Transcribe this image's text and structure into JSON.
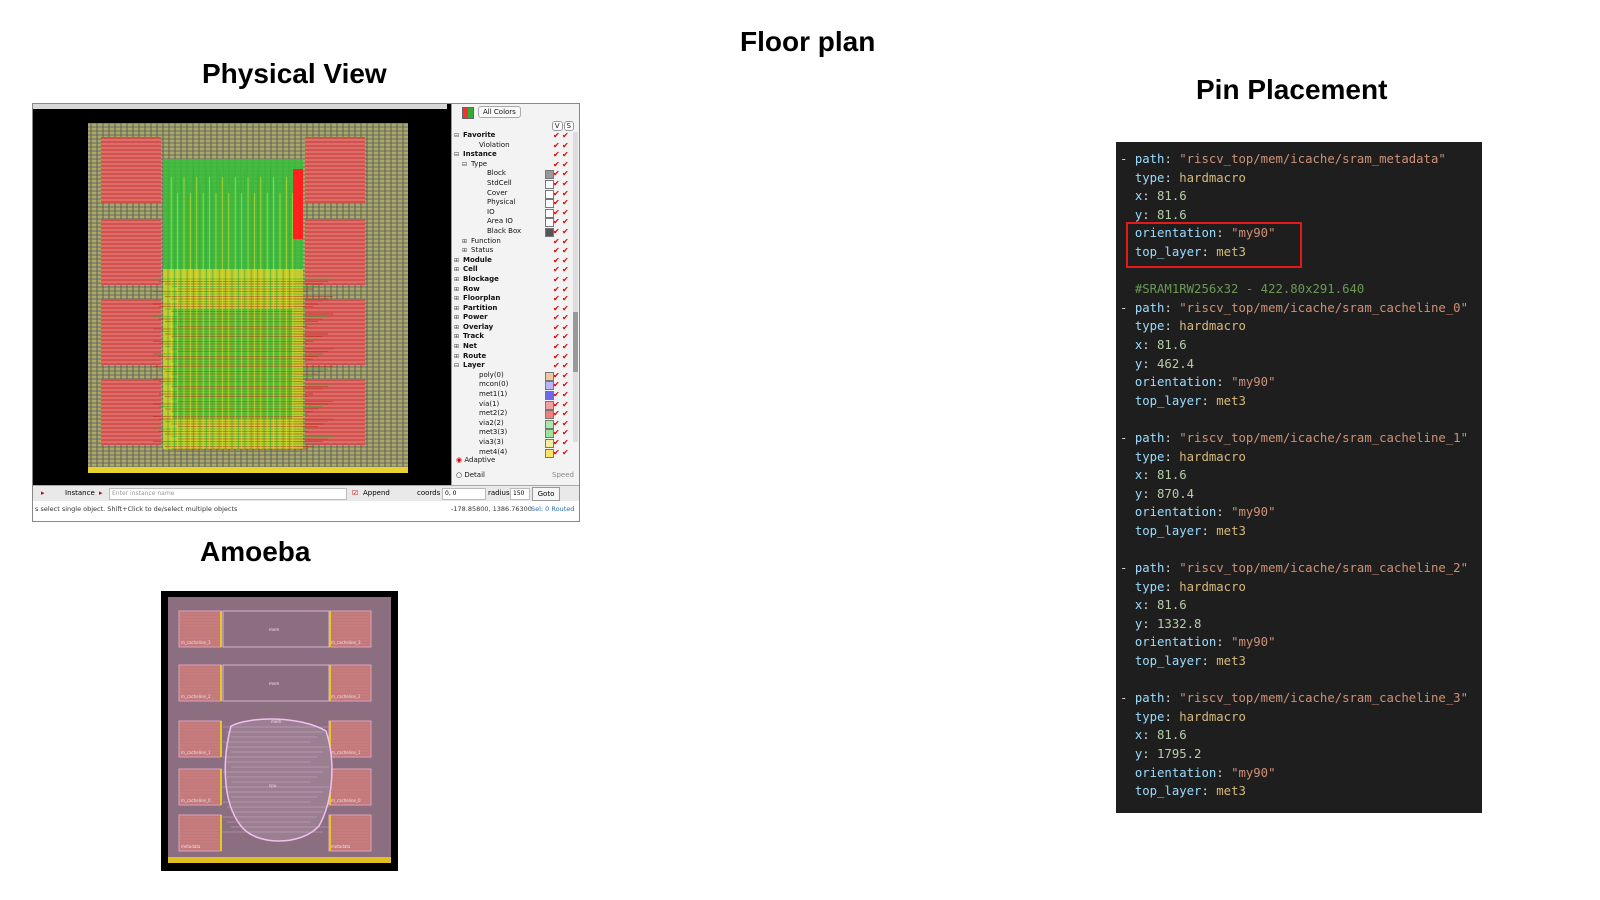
{
  "titles": {
    "main": "Floor plan",
    "physical": "Physical View",
    "amoeba": "Amoeba",
    "pins": "Pin Placement"
  },
  "viewer": {
    "all_colors": "All Colors",
    "v_button": "V",
    "s_button": "S",
    "tree": [
      {
        "label": "Favorite",
        "indent": 0,
        "bold": true,
        "exp": "⊟"
      },
      {
        "label": "Violation",
        "indent": 2,
        "bold": false,
        "exp": ""
      },
      {
        "label": "Instance",
        "indent": 0,
        "bold": true,
        "exp": "⊟"
      },
      {
        "label": "Type",
        "indent": 1,
        "bold": false,
        "exp": "⊟"
      },
      {
        "label": "Block",
        "indent": 3,
        "bold": false,
        "exp": ""
      },
      {
        "label": "StdCell",
        "indent": 3,
        "bold": false,
        "exp": ""
      },
      {
        "label": "Cover",
        "indent": 3,
        "bold": false,
        "exp": ""
      },
      {
        "label": "Physical",
        "indent": 3,
        "bold": false,
        "exp": ""
      },
      {
        "label": "IO",
        "indent": 3,
        "bold": false,
        "exp": ""
      },
      {
        "label": "Area IO",
        "indent": 3,
        "bold": false,
        "exp": ""
      },
      {
        "label": "Black Box",
        "indent": 3,
        "bold": false,
        "exp": ""
      },
      {
        "label": "Function",
        "indent": 1,
        "bold": false,
        "exp": "⊞"
      },
      {
        "label": "Status",
        "indent": 1,
        "bold": false,
        "exp": "⊞"
      },
      {
        "label": "Module",
        "indent": 0,
        "bold": true,
        "exp": "⊞"
      },
      {
        "label": "Cell",
        "indent": 0,
        "bold": true,
        "exp": "⊞"
      },
      {
        "label": "Blockage",
        "indent": 0,
        "bold": true,
        "exp": "⊞"
      },
      {
        "label": "Row",
        "indent": 0,
        "bold": true,
        "exp": "⊞"
      },
      {
        "label": "Floorplan",
        "indent": 0,
        "bold": true,
        "exp": "⊞"
      },
      {
        "label": "Partition",
        "indent": 0,
        "bold": true,
        "exp": "⊞"
      },
      {
        "label": "Power",
        "indent": 0,
        "bold": true,
        "exp": "⊞"
      },
      {
        "label": "Overlay",
        "indent": 0,
        "bold": true,
        "exp": "⊞"
      },
      {
        "label": "Track",
        "indent": 0,
        "bold": true,
        "exp": "⊞"
      },
      {
        "label": "Net",
        "indent": 0,
        "bold": true,
        "exp": "⊞"
      },
      {
        "label": "Route",
        "indent": 0,
        "bold": true,
        "exp": "⊞"
      },
      {
        "label": "Layer",
        "indent": 0,
        "bold": true,
        "exp": "⊟"
      },
      {
        "label": "poly(0)",
        "indent": 2,
        "bold": false,
        "exp": "",
        "swatch": "#f4c7a0"
      },
      {
        "label": "mcon(0)",
        "indent": 2,
        "bold": false,
        "exp": "",
        "swatch": "#b8b8f8"
      },
      {
        "label": "met1(1)",
        "indent": 2,
        "bold": false,
        "exp": "",
        "swatch": "#6a6ae8"
      },
      {
        "label": "via(1)",
        "indent": 2,
        "bold": false,
        "exp": "",
        "swatch": "#f0a0a0"
      },
      {
        "label": "met2(2)",
        "indent": 2,
        "bold": false,
        "exp": "",
        "swatch": "#f08080"
      },
      {
        "label": "via2(2)",
        "indent": 2,
        "bold": false,
        "exp": "",
        "swatch": "#a8e8a8"
      },
      {
        "label": "met3(3)",
        "indent": 2,
        "bold": false,
        "exp": "",
        "swatch": "#9de39d"
      },
      {
        "label": "via3(3)",
        "indent": 2,
        "bold": false,
        "exp": "",
        "swatch": "#f0f0a0"
      },
      {
        "label": "met4(4)",
        "indent": 2,
        "bold": false,
        "exp": "",
        "swatch": "#f5e56a"
      }
    ],
    "adaptive": "Adaptive",
    "detail": "Detail",
    "speed": "Speed",
    "bottom": {
      "instance_label": "Instance",
      "instance_placeholder": "Enter instance name",
      "append_label": "Append",
      "coords_label": "coords",
      "coords_value": "0, 0",
      "radius_label": "radius",
      "radius_value": "150",
      "goto_label": "Goto"
    },
    "status_left": "s select single object. Shift+Click to de/select multiple objects",
    "status_right": "-178.85800, 1386.76300",
    "status_sel": "Sel: 0 Routed"
  },
  "amoeba": {
    "macro_labels": [
      "m_cacheline_3",
      "m_cacheline_3",
      "m_cacheline_2",
      "m_cacheline_2",
      "m_cacheline_1",
      "m_cacheline_1",
      "m_cacheline_0",
      "m_cacheline_0",
      "metadata",
      "metadata"
    ],
    "block_labels": [
      "mem",
      "mem",
      "mem",
      "cpu"
    ]
  },
  "code": {
    "lines": [
      [
        [
          "- ",
          "dash"
        ],
        [
          "path",
          "k"
        ],
        [
          ": ",
          "p"
        ],
        [
          "\"riscv_top/mem/icache/sram_metadata\"",
          "s"
        ]
      ],
      [
        [
          "  ",
          "p"
        ],
        [
          "type",
          "k"
        ],
        [
          ": ",
          "p"
        ],
        [
          "hardmacro",
          "ty"
        ]
      ],
      [
        [
          "  ",
          "p"
        ],
        [
          "x",
          "k"
        ],
        [
          ": ",
          "p"
        ],
        [
          "81.6",
          "n"
        ]
      ],
      [
        [
          "  ",
          "p"
        ],
        [
          "y",
          "k"
        ],
        [
          ": ",
          "p"
        ],
        [
          "81.6",
          "n"
        ]
      ],
      [
        [
          "  ",
          "p"
        ],
        [
          "orientation",
          "k"
        ],
        [
          ": ",
          "p"
        ],
        [
          "\"my90\"",
          "s"
        ]
      ],
      [
        [
          "  ",
          "p"
        ],
        [
          "top_layer",
          "k"
        ],
        [
          ": ",
          "p"
        ],
        [
          "met3",
          "ty"
        ]
      ],
      [
        [
          "",
          "p"
        ]
      ],
      [
        [
          "  ",
          "p"
        ],
        [
          "#SRAM1RW256x32 - 422.80x291.640",
          "c"
        ]
      ],
      [
        [
          "- ",
          "dash"
        ],
        [
          "path",
          "k"
        ],
        [
          ": ",
          "p"
        ],
        [
          "\"riscv_top/mem/icache/sram_cacheline_0\"",
          "s"
        ]
      ],
      [
        [
          "  ",
          "p"
        ],
        [
          "type",
          "k"
        ],
        [
          ": ",
          "p"
        ],
        [
          "hardmacro",
          "ty"
        ]
      ],
      [
        [
          "  ",
          "p"
        ],
        [
          "x",
          "k"
        ],
        [
          ": ",
          "p"
        ],
        [
          "81.6",
          "n"
        ]
      ],
      [
        [
          "  ",
          "p"
        ],
        [
          "y",
          "k"
        ],
        [
          ": ",
          "p"
        ],
        [
          "462.4",
          "n"
        ]
      ],
      [
        [
          "  ",
          "p"
        ],
        [
          "orientation",
          "k"
        ],
        [
          ": ",
          "p"
        ],
        [
          "\"my90\"",
          "s"
        ]
      ],
      [
        [
          "  ",
          "p"
        ],
        [
          "top_layer",
          "k"
        ],
        [
          ": ",
          "p"
        ],
        [
          "met3",
          "ty"
        ]
      ],
      [
        [
          "",
          "p"
        ]
      ],
      [
        [
          "- ",
          "dash"
        ],
        [
          "path",
          "k"
        ],
        [
          ": ",
          "p"
        ],
        [
          "\"riscv_top/mem/icache/sram_cacheline_1\"",
          "s"
        ]
      ],
      [
        [
          "  ",
          "p"
        ],
        [
          "type",
          "k"
        ],
        [
          ": ",
          "p"
        ],
        [
          "hardmacro",
          "ty"
        ]
      ],
      [
        [
          "  ",
          "p"
        ],
        [
          "x",
          "k"
        ],
        [
          ": ",
          "p"
        ],
        [
          "81.6",
          "n"
        ]
      ],
      [
        [
          "  ",
          "p"
        ],
        [
          "y",
          "k"
        ],
        [
          ": ",
          "p"
        ],
        [
          "870.4",
          "n"
        ]
      ],
      [
        [
          "  ",
          "p"
        ],
        [
          "orientation",
          "k"
        ],
        [
          ": ",
          "p"
        ],
        [
          "\"my90\"",
          "s"
        ]
      ],
      [
        [
          "  ",
          "p"
        ],
        [
          "top_layer",
          "k"
        ],
        [
          ": ",
          "p"
        ],
        [
          "met3",
          "ty"
        ]
      ],
      [
        [
          "",
          "p"
        ]
      ],
      [
        [
          "- ",
          "dash"
        ],
        [
          "path",
          "k"
        ],
        [
          ": ",
          "p"
        ],
        [
          "\"riscv_top/mem/icache/sram_cacheline_2\"",
          "s"
        ]
      ],
      [
        [
          "  ",
          "p"
        ],
        [
          "type",
          "k"
        ],
        [
          ": ",
          "p"
        ],
        [
          "hardmacro",
          "ty"
        ]
      ],
      [
        [
          "  ",
          "p"
        ],
        [
          "x",
          "k"
        ],
        [
          ": ",
          "p"
        ],
        [
          "81.6",
          "n"
        ]
      ],
      [
        [
          "  ",
          "p"
        ],
        [
          "y",
          "k"
        ],
        [
          ": ",
          "p"
        ],
        [
          "1332.8",
          "n"
        ]
      ],
      [
        [
          "  ",
          "p"
        ],
        [
          "orientation",
          "k"
        ],
        [
          ": ",
          "p"
        ],
        [
          "\"my90\"",
          "s"
        ]
      ],
      [
        [
          "  ",
          "p"
        ],
        [
          "top_layer",
          "k"
        ],
        [
          ": ",
          "p"
        ],
        [
          "met3",
          "ty"
        ]
      ],
      [
        [
          "",
          "p"
        ]
      ],
      [
        [
          "- ",
          "dash"
        ],
        [
          "path",
          "k"
        ],
        [
          ": ",
          "p"
        ],
        [
          "\"riscv_top/mem/icache/sram_cacheline_3\"",
          "s"
        ]
      ],
      [
        [
          "  ",
          "p"
        ],
        [
          "type",
          "k"
        ],
        [
          ": ",
          "p"
        ],
        [
          "hardmacro",
          "ty"
        ]
      ],
      [
        [
          "  ",
          "p"
        ],
        [
          "x",
          "k"
        ],
        [
          ": ",
          "p"
        ],
        [
          "81.6",
          "n"
        ]
      ],
      [
        [
          "  ",
          "p"
        ],
        [
          "y",
          "k"
        ],
        [
          ": ",
          "p"
        ],
        [
          "1795.2",
          "n"
        ]
      ],
      [
        [
          "  ",
          "p"
        ],
        [
          "orientation",
          "k"
        ],
        [
          ": ",
          "p"
        ],
        [
          "\"my90\"",
          "s"
        ]
      ],
      [
        [
          "  ",
          "p"
        ],
        [
          "top_layer",
          "k"
        ],
        [
          ": ",
          "p"
        ],
        [
          "met3",
          "ty"
        ]
      ]
    ],
    "highlight_color": "#e41919",
    "colors": {
      "key": "#9cdcfe",
      "string": "#ce9178",
      "number": "#b5cea8",
      "type": "#d7ba7d",
      "comment": "#6a9955",
      "bg": "#1e1e1e"
    }
  }
}
